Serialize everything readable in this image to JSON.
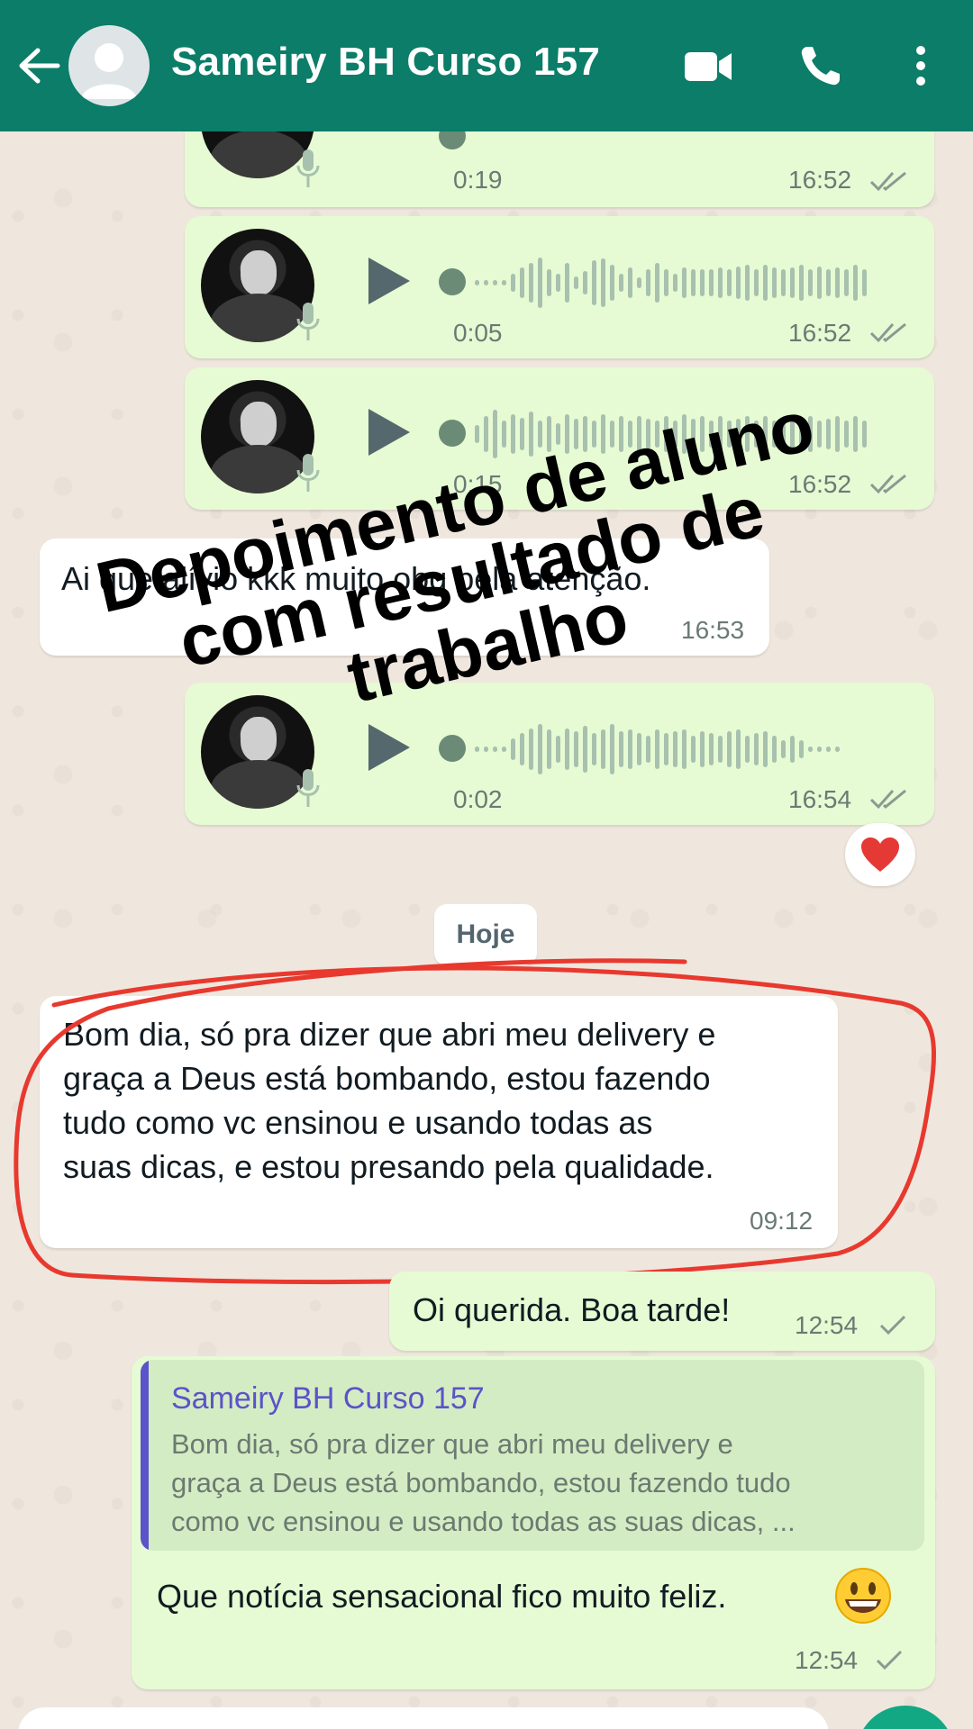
{
  "header": {
    "title": "Sameiry BH Curso 157",
    "color": "#0b7d69"
  },
  "messages": {
    "audio1": {
      "duration": "0:19",
      "time": "16:52"
    },
    "audio2": {
      "duration": "0:05",
      "time": "16:52"
    },
    "audio3": {
      "duration": "0:15",
      "time": "16:52"
    },
    "incoming1": {
      "text": "Ai que alívio kkk muito obg pela atenção.",
      "time": "16:53"
    },
    "audio4": {
      "duration": "0:02",
      "time": "16:54"
    },
    "reaction": "❤️",
    "day_separator": "Hoje",
    "incoming2": {
      "lines": [
        "Bom dia, só pra dizer que abri meu delivery e",
        "graça a Deus está bombando, estou fazendo",
        "tudo como vc ensinou e usando todas as",
        "suas dicas, e estou presando pela qualidade."
      ],
      "time": "09:12"
    },
    "outgoing1": {
      "text": "Oi querida. Boa tarde!",
      "time": "12:54"
    },
    "reply": {
      "quoted_name": "Sameiry BH Curso 157",
      "quoted_lines": [
        "Bom dia, só pra dizer que abri meu delivery e",
        "graça a Deus está bombando, estou fazendo tudo",
        "como vc ensinou e usando todas as suas dicas, ..."
      ],
      "text": "Que notícia sensacional fico muito feliz.",
      "time": "12:54"
    }
  },
  "overlay": {
    "lines": [
      "Depoimento de aluno",
      "com resultado de",
      "trabalho"
    ]
  },
  "colors": {
    "outgoing_bubble": "#e6fbd3",
    "incoming_bubble": "#ffffff",
    "highlight_circle": "#e8392f",
    "quote_accent": "#5b53c9"
  }
}
